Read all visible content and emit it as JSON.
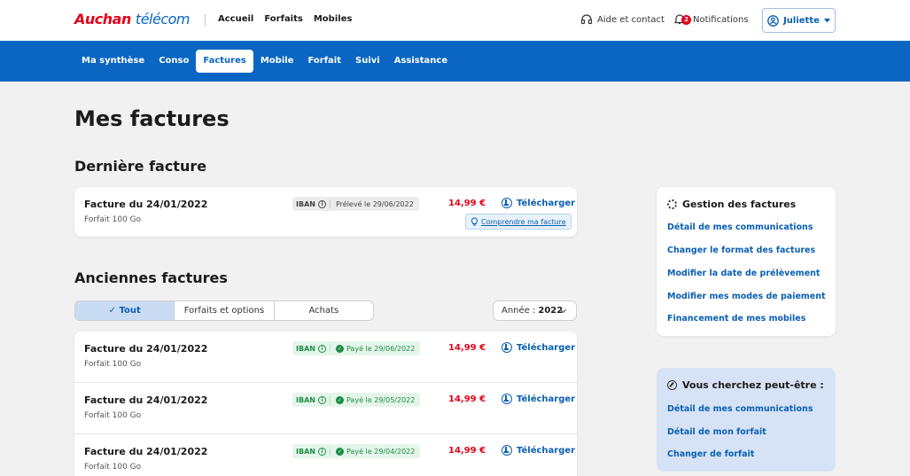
{
  "header": {
    "logo_brand": "Auchan",
    "logo_product": "télécom",
    "nav": [
      "Accueil",
      "Forfaits",
      "Mobiles"
    ],
    "help_label": "Aide et contact",
    "notifications_label": "Notifications",
    "notifications_count": "2",
    "user_name": "Juliette"
  },
  "subnav": {
    "items": [
      "Ma synthèse",
      "Conso",
      "Factures",
      "Mobile",
      "Forfait",
      "Suivi",
      "Assistance"
    ],
    "active": "Factures"
  },
  "page_title": "Mes factures",
  "last_invoice": {
    "section_title": "Dernière facture",
    "title": "Facture du 24/01/2022",
    "plan": "Forfait 100 Go",
    "payment_method": "IBAN",
    "status": "Prélevé le 29/06/2022",
    "amount": "14,99 €",
    "download_label": "Télécharger",
    "understand_label": "Comprendre ma facture"
  },
  "old_invoices": {
    "section_title": "Anciennes factures",
    "filters": [
      "Tout",
      "Forfaits et options",
      "Achats"
    ],
    "active_filter": "Tout",
    "year_label": "Année :",
    "year_value": "2022",
    "rows": [
      {
        "title": "Facture du 24/01/2022",
        "plan": "Forfait 100 Go",
        "payment_method": "IBAN",
        "status": "Payé le 29/06/2022",
        "amount": "14,99 €",
        "download_label": "Télécharger"
      },
      {
        "title": "Facture du 24/01/2022",
        "plan": "Forfait 100 Go",
        "payment_method": "IBAN",
        "status": "Payé le 29/05/2022",
        "amount": "14,99 €",
        "download_label": "Télécharger"
      },
      {
        "title": "Facture du 24/01/2022",
        "plan": "Forfait 100 Go",
        "payment_method": "IBAN",
        "status": "Payé le 29/04/2022",
        "amount": "14,99 €",
        "download_label": "Télécharger"
      }
    ]
  },
  "management_panel": {
    "title": "Gestion des factures",
    "links": [
      "Détail de mes communications",
      "Changer le format des factures",
      "Modifier la date de prélèvement",
      "Modifier mes modes de paiement",
      "Financement de mes mobiles"
    ]
  },
  "suggestions_panel": {
    "title": "Vous cherchez peut-être :",
    "links": [
      "Détail de mes communications",
      "Détail de mon forfait",
      "Changer de forfait"
    ]
  },
  "colors": {
    "brand_red": "#e2001a",
    "brand_blue": "#0a66c2",
    "paid_green": "#1d8d44",
    "suggestion_bg": "#d6e3f6"
  }
}
